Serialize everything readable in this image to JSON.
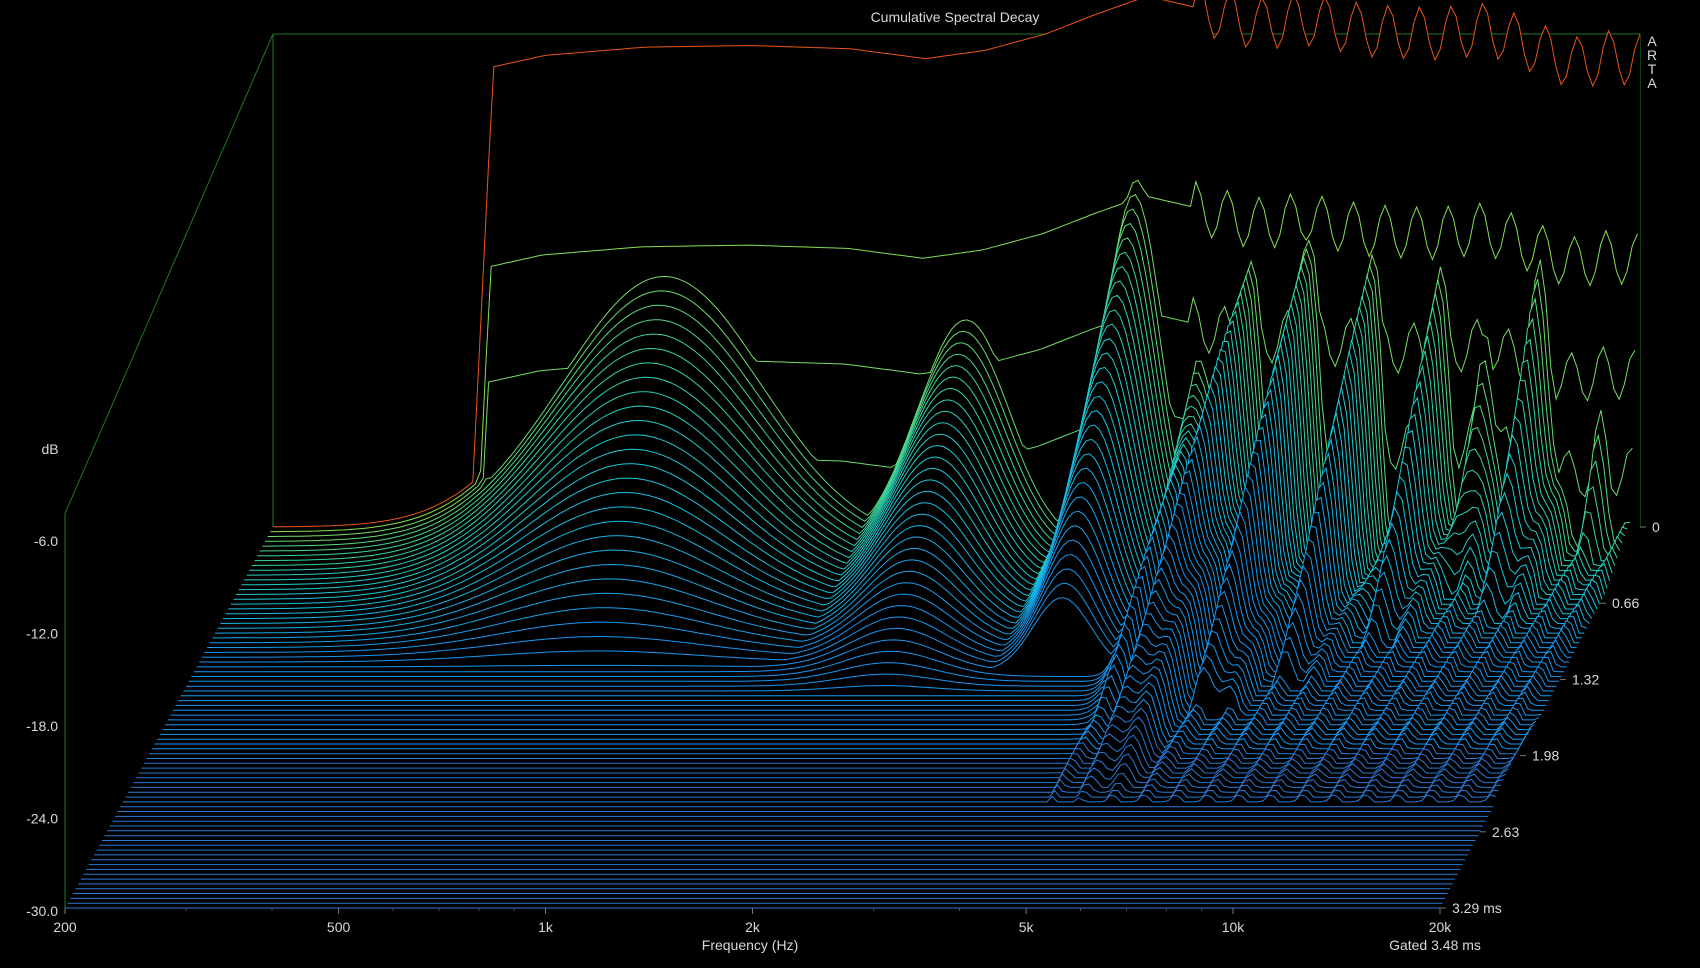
{
  "chart_data": {
    "type": "waterfall",
    "title": "Cumulative Spectral Decay",
    "xlabel": "Frequency (Hz)",
    "xscale": "log",
    "xlim": [
      200,
      20000
    ],
    "x_ticks": [
      {
        "value": 200,
        "label": "200"
      },
      {
        "value": 500,
        "label": "500"
      },
      {
        "value": 1000,
        "label": "1k"
      },
      {
        "value": 2000,
        "label": "2k"
      },
      {
        "value": 5000,
        "label": "5k"
      },
      {
        "value": 10000,
        "label": "10k"
      },
      {
        "value": 20000,
        "label": "20k"
      }
    ],
    "zlabel": "dB",
    "zlim": [
      -30,
      0
    ],
    "z_ticks": [
      "-6.0",
      "-12.0",
      "-18.0",
      "-24.0",
      "-30.0"
    ],
    "time_ticks": [
      "0",
      "0.66",
      "1.32",
      "1.98",
      "2.63",
      "3.29 ms"
    ],
    "time_range_ms": [
      0,
      3.29
    ],
    "slice_count": 80,
    "gating_note": "Gated 3.48 ms",
    "watermark": "ARTA",
    "colorbar_colors": [
      "#cc1414",
      "#e23616",
      "#f07a18",
      "#f0c018",
      "#f5f218",
      "#9be040",
      "#3ed58e",
      "#18c0d8",
      "#189ef0"
    ],
    "floor_color": "#2a7ad6",
    "frame_color": "#1e7a1e",
    "initial_response_db": [
      {
        "freq": 230,
        "db": -29.5
      },
      {
        "freq": 390,
        "db": -29.5
      },
      {
        "freq": 420,
        "db": -2.0
      },
      {
        "freq": 500,
        "db": -1.3
      },
      {
        "freq": 700,
        "db": -0.8
      },
      {
        "freq": 1000,
        "db": -0.7
      },
      {
        "freq": 1400,
        "db": -0.9
      },
      {
        "freq": 1800,
        "db": -1.5
      },
      {
        "freq": 2200,
        "db": -1.0
      },
      {
        "freq": 2700,
        "db": 0.0
      },
      {
        "freq": 3200,
        "db": 1.2
      },
      {
        "freq": 3800,
        "db": 2.3
      },
      {
        "freq": 4500,
        "db": 1.6
      },
      {
        "freq": 5500,
        "db": 0.6
      },
      {
        "freq": 6500,
        "db": 0.9
      },
      {
        "freq": 8000,
        "db": 0.2
      },
      {
        "freq": 10000,
        "db": 0.0
      },
      {
        "freq": 12000,
        "db": 0.3
      },
      {
        "freq": 14000,
        "db": -0.8
      },
      {
        "freq": 16000,
        "db": -1.8
      },
      {
        "freq": 18000,
        "db": -1.4
      },
      {
        "freq": 20000,
        "db": -1.6
      }
    ],
    "resonances": [
      {
        "freq": 760,
        "sigma_oct": 0.5,
        "peak_db": -13,
        "decay_ms": 1.0
      },
      {
        "freq": 2100,
        "sigma_oct": 0.23,
        "peak_db": -16,
        "decay_ms": 1.45
      },
      {
        "freq": 3700,
        "sigma_oct": 0.14,
        "peak_db": -8,
        "decay_ms": 1.0
      },
      {
        "freq": 4700,
        "sigma_oct": 0.06,
        "peak_db": -17,
        "decay_ms": 1.9
      },
      {
        "freq": 5400,
        "sigma_oct": 0.09,
        "peak_db": -13,
        "decay_ms": 1.9
      },
      {
        "freq": 6600,
        "sigma_oct": 0.07,
        "peak_db": -10,
        "decay_ms": 1.3
      },
      {
        "freq": 8200,
        "sigma_oct": 0.06,
        "peak_db": -11,
        "decay_ms": 1.1
      },
      {
        "freq": 10300,
        "sigma_oct": 0.07,
        "peak_db": -13,
        "decay_ms": 0.9
      },
      {
        "freq": 12200,
        "sigma_oct": 0.05,
        "peak_db": -15,
        "decay_ms": 0.6
      },
      {
        "freq": 14500,
        "sigma_oct": 0.07,
        "peak_db": -13,
        "decay_ms": 0.7
      },
      {
        "freq": 18000,
        "sigma_oct": 0.05,
        "peak_db": -20,
        "decay_ms": 0.5
      }
    ]
  }
}
